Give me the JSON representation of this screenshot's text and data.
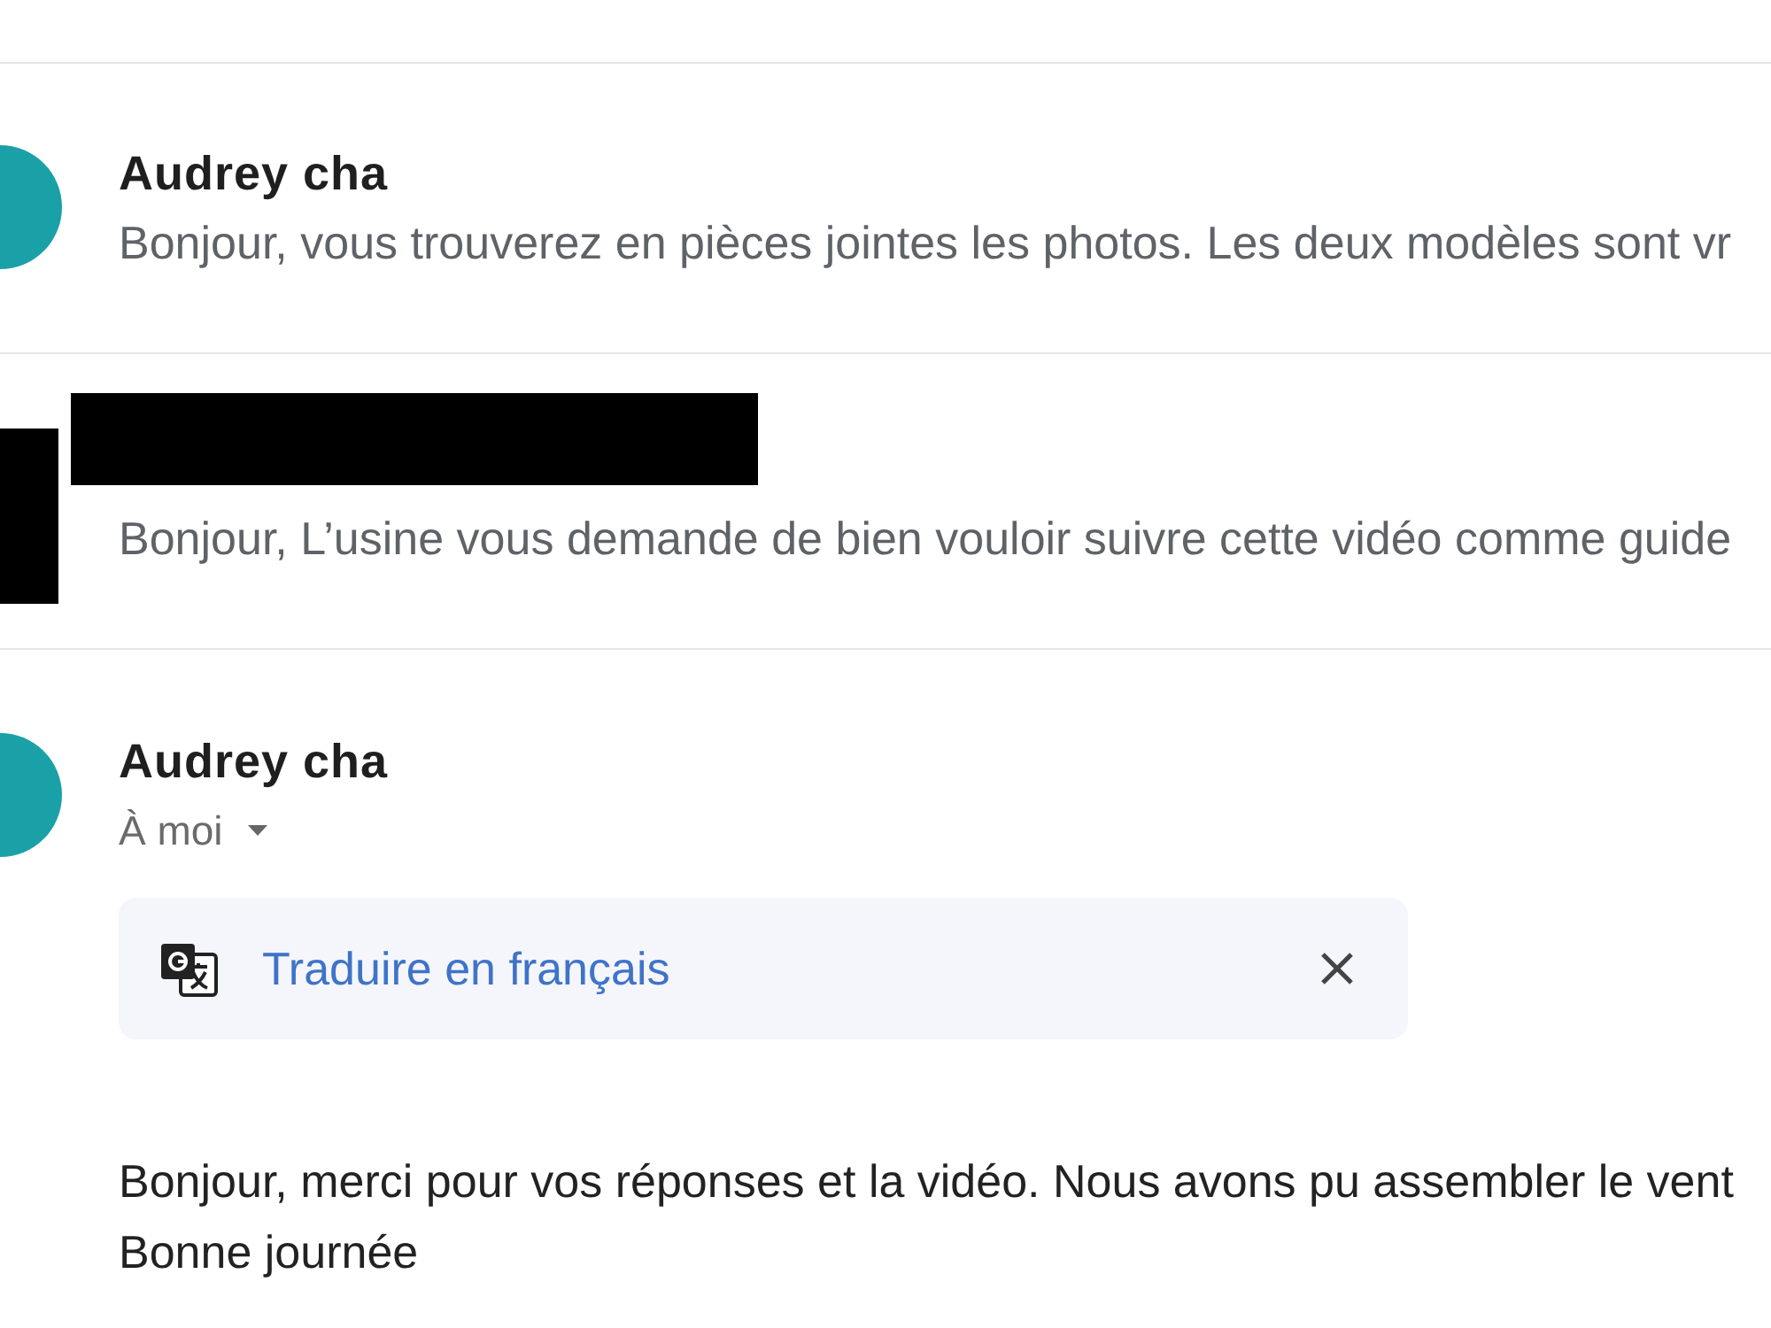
{
  "conversation": {
    "messages": [
      {
        "kind": "collapsed",
        "sender": "Audrey cha",
        "snippet": "Bonjour, vous trouverez en pièces jointes les photos. Les deux modèles sont vr"
      },
      {
        "kind": "redacted",
        "snippet": "Bonjour, L’usine vous demande de bien vouloir suivre cette vidéo comme guide"
      },
      {
        "kind": "expanded",
        "sender": "Audrey cha",
        "recipient": "À moi",
        "translate_banner": {
          "label": "Traduire en français"
        },
        "body": [
          "Bonjour, merci pour vos réponses et la vidéo. Nous avons pu assembler le vent",
          "Bonne journée"
        ]
      }
    ]
  }
}
